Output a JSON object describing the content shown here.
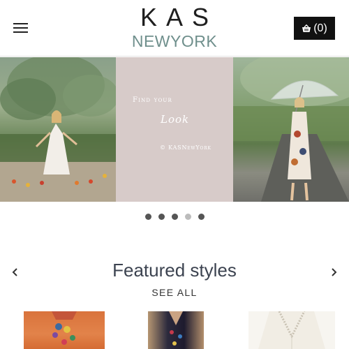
{
  "header": {
    "menu_icon": "hamburger-menu-icon",
    "logo_top": "KAS",
    "logo_bottom": "NEWYORK",
    "cart_icon": "shopping-basket-icon",
    "cart_count": "(0)"
  },
  "hero": {
    "find_your": "Find your",
    "look": "Look",
    "copyright": "© KASNewYork"
  },
  "carousel": {
    "dot_count": 5,
    "active_index": 4
  },
  "featured": {
    "title": "Featured styles",
    "see_all": "SEE ALL",
    "prev_icon": "chevron-left-icon",
    "next_icon": "chevron-right-icon"
  },
  "colors": {
    "accent_logo": "#6f8f8c",
    "cart_bg": "#111111",
    "hero_mid_bg": "#d7cbc9"
  }
}
